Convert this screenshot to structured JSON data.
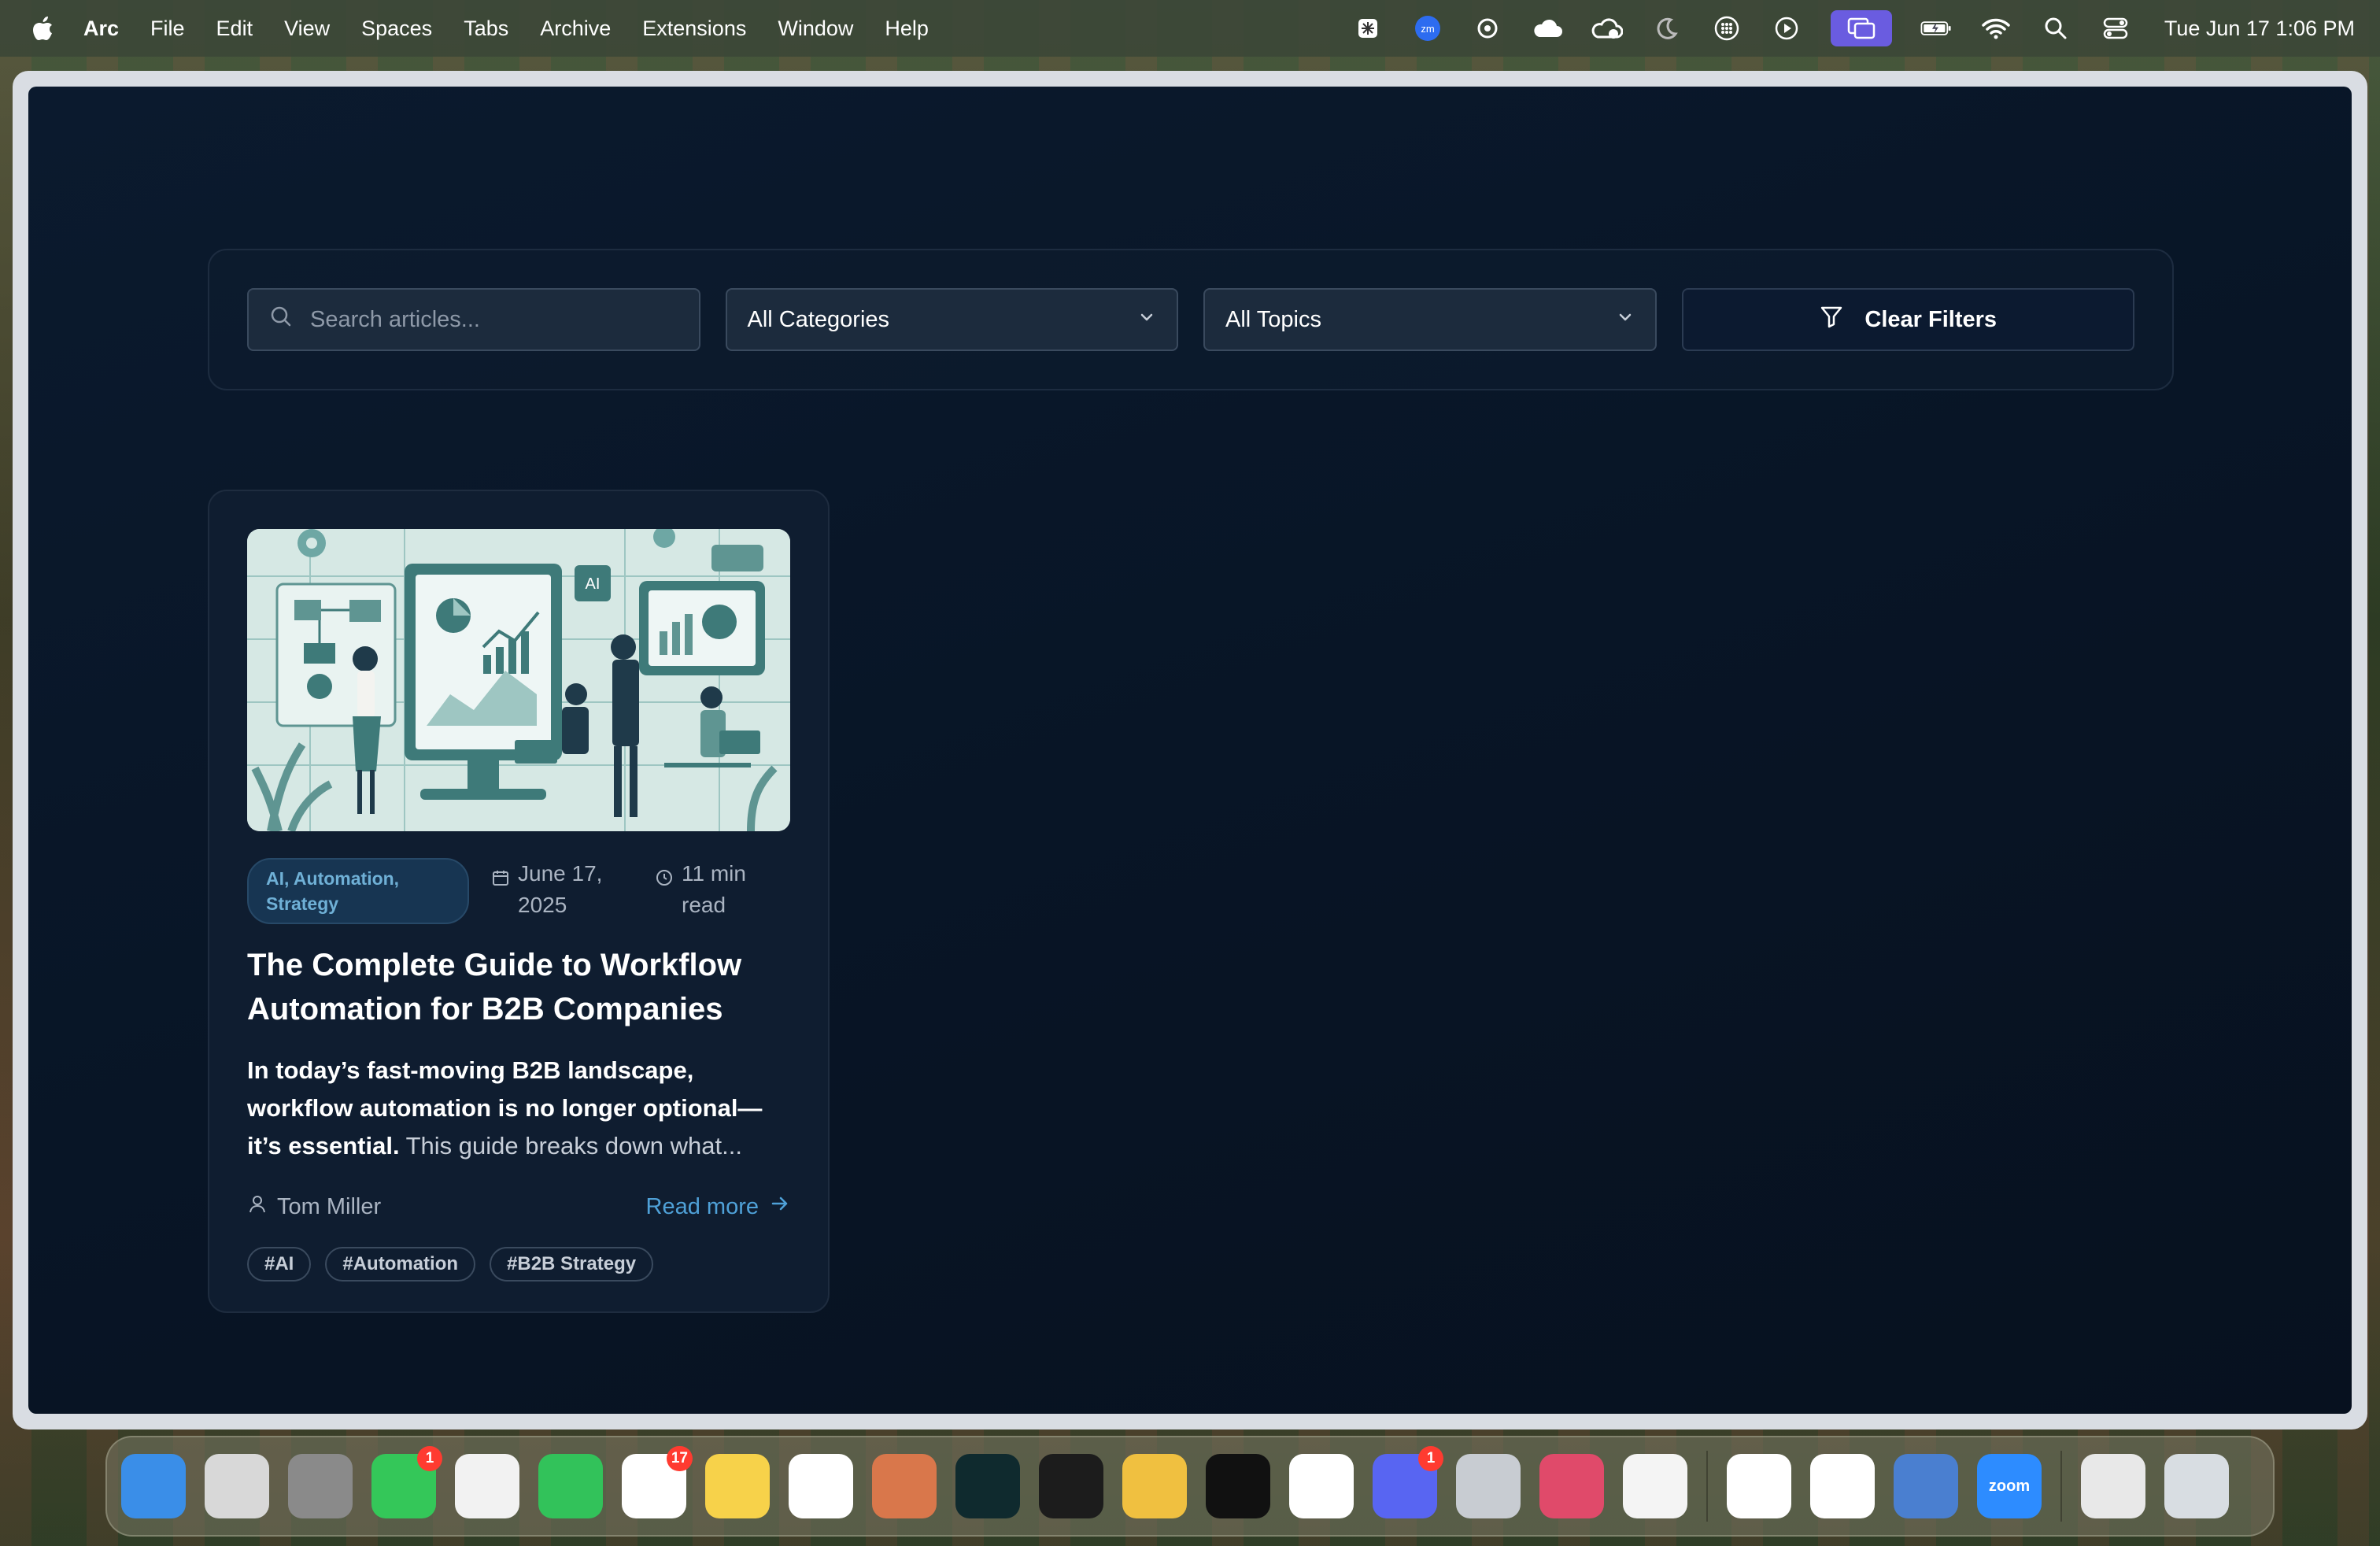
{
  "menubar": {
    "app_name": "Arc",
    "menus": [
      "File",
      "Edit",
      "View",
      "Spaces",
      "Tabs",
      "Archive",
      "Extensions",
      "Window",
      "Help"
    ],
    "clock": "Tue Jun 17  1:06 PM"
  },
  "filters": {
    "search_placeholder": "Search articles...",
    "category_value": "All Categories",
    "topic_value": "All Topics",
    "clear_label": "Clear Filters"
  },
  "article": {
    "categories": "AI, Automation, Strategy",
    "date": "June 17, 2025",
    "read_time": "11 min read",
    "title": "The Complete Guide to Workflow Automation for B2B Companies",
    "excerpt_bold": "In today’s fast-moving B2B landscape, workflow automation is no longer optional—it’s essential.",
    "excerpt_rest": " This guide breaks down what...",
    "author": "Tom Miller",
    "read_more": "Read more",
    "tags": [
      "#AI",
      "#Automation",
      "#B2B Strategy"
    ],
    "hero_chip_label": "AI"
  },
  "dock": {
    "apps": [
      {
        "name": "finder-app",
        "color": "#3a8ee8",
        "label": "",
        "badge": ""
      },
      {
        "name": "launchpad-app",
        "color": "#d8d8d8",
        "label": "",
        "badge": ""
      },
      {
        "name": "system-settings-app",
        "color": "#8a8a8a",
        "label": "",
        "badge": ""
      },
      {
        "name": "messages-app",
        "color": "#34c759",
        "label": "",
        "badge": "1"
      },
      {
        "name": "photos-app",
        "color": "#f2f2f2",
        "label": "",
        "badge": ""
      },
      {
        "name": "facetime-app",
        "color": "#32c25a",
        "label": "",
        "badge": ""
      },
      {
        "name": "reminders-app",
        "color": "#ffffff",
        "label": "",
        "badge": "17"
      },
      {
        "name": "notes-app",
        "color": "#f7d24a",
        "label": "",
        "badge": ""
      },
      {
        "name": "chatgpt-app",
        "color": "#ffffff",
        "label": "",
        "badge": ""
      },
      {
        "name": "claude-app",
        "color": "#d9774b",
        "label": "",
        "badge": ""
      },
      {
        "name": "perplexity-app",
        "color": "#0f2a2e",
        "label": "",
        "badge": ""
      },
      {
        "name": "replit-app",
        "color": "#1c1c1c",
        "label": "",
        "badge": ""
      },
      {
        "name": "airmail-app",
        "color": "#f0c040",
        "label": "",
        "badge": ""
      },
      {
        "name": "screenshot-app",
        "color": "#111111",
        "label": "",
        "badge": ""
      },
      {
        "name": "notion-app",
        "color": "#ffffff",
        "label": "",
        "badge": ""
      },
      {
        "name": "discord-app",
        "color": "#5865f2",
        "label": "",
        "badge": "1"
      },
      {
        "name": "iphone-mirroring-app",
        "color": "#c8ccd2",
        "label": "",
        "badge": ""
      },
      {
        "name": "affinity-app",
        "color": "#e04a6a",
        "label": "",
        "badge": ""
      },
      {
        "name": "passwords-app",
        "color": "#f4f4f4",
        "label": "",
        "badge": ""
      },
      {
        "name": "slack-app",
        "color": "#ffffff",
        "label": "",
        "badge": ""
      },
      {
        "name": "chrome-app",
        "color": "#ffffff",
        "label": "",
        "badge": ""
      },
      {
        "name": "screen-sharing-app",
        "color": "#4a7fd0",
        "label": "",
        "badge": ""
      },
      {
        "name": "zoom-app",
        "color": "#2d8cff",
        "label": "zoom",
        "badge": ""
      },
      {
        "name": "archive-utility-app",
        "color": "#e8e8e8",
        "label": "",
        "badge": ""
      },
      {
        "name": "trash-app",
        "color": "#d8dde2",
        "label": "",
        "badge": ""
      }
    ]
  }
}
